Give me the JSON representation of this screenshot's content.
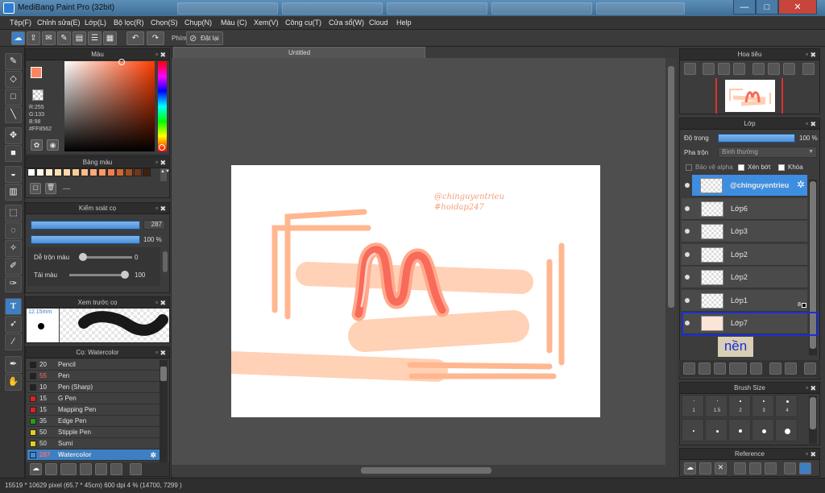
{
  "window": {
    "title": "MediBang Paint Pro (32bit)",
    "minimize": "—",
    "maximize": "□",
    "close": "✕"
  },
  "menu": [
    "Tệp(F)",
    "Chỉnh sửa(E)",
    "Lớp(L)",
    "Bộ lọc(R)",
    "Chọn(S)",
    "Chụp(N)",
    "Màu (C)",
    "Xem(V)",
    "Công cụ(T)",
    "Cửa sổ(W)",
    "Cloud",
    "Help"
  ],
  "toolbar": {
    "snap_label": "Phím",
    "reset_label": "Đặt lại"
  },
  "color_panel": {
    "title": "Màu",
    "r": "R:255",
    "g": "G:133",
    "b": "B:98",
    "hex": "#FF8562",
    "main_color": "#ff8562"
  },
  "palette_panel": {
    "title": "Bảng màu",
    "dash": "---",
    "swatches": [
      "#ffffff",
      "#fff6e8",
      "#ffeccc",
      "#ffe0b2",
      "#ffd9a8",
      "#ffcc99",
      "#ffbb88",
      "#ffaa77",
      "#ff9966",
      "#f08050",
      "#d06a35",
      "#a05020",
      "#703818",
      "#402010"
    ]
  },
  "brush_control": {
    "title": "Kiểm soát cọ",
    "size_value": "287",
    "opacity_value": "100 %",
    "blend_label": "Dễ trộn màu",
    "blend_value": "0",
    "amount_label": "Tải màu",
    "amount_value": "100"
  },
  "brush_preview": {
    "title": "Xem trước cọ",
    "size_label": "12.15mm"
  },
  "brush_list": {
    "title": "Cọ: Watercolor",
    "items": [
      {
        "size": "20",
        "name": "Pencil",
        "color": "#222222"
      },
      {
        "size": "55",
        "name": "Pen",
        "color": "#222222"
      },
      {
        "size": "10",
        "name": "Pen (Sharp)",
        "color": "#222222"
      },
      {
        "size": "15",
        "name": "G Pen",
        "color": "#e02020"
      },
      {
        "size": "15",
        "name": "Mapping Pen",
        "color": "#e02020"
      },
      {
        "size": "35",
        "name": "Edge Pen",
        "color": "#20a020"
      },
      {
        "size": "50",
        "name": "Stipple Pen",
        "color": "#e0d020"
      },
      {
        "size": "50",
        "name": "Sumi",
        "color": "#e0d020"
      },
      {
        "size": "287",
        "name": "Watercolor",
        "color": "#3a8ee6"
      }
    ]
  },
  "canvas": {
    "tab_title": "Untitled",
    "watermark_line1": "@chinguyentrieu",
    "watermark_line2": "#hoidap247"
  },
  "navigator": {
    "title": "Hoa tiêu"
  },
  "layer_panel": {
    "title": "Lớp",
    "opacity_label": "Độ trong",
    "opacity_value": "100 %",
    "blend_label": "Pha trộn",
    "blend_value": "Bình thường",
    "protect_alpha": "Bảo vệ alpha",
    "clipping": "Xén bớt",
    "lock": "Khóa",
    "layers": [
      {
        "name": "@chinguyentrieu",
        "selected": true
      },
      {
        "name": "Lớp6",
        "selected": false
      },
      {
        "name": "Lớp3",
        "selected": false
      },
      {
        "name": "Lớp2",
        "selected": false
      },
      {
        "name": "Lớp2",
        "selected": false
      },
      {
        "name": "Lớp1",
        "selected": false
      },
      {
        "name": "Lớp7",
        "selected": false
      }
    ],
    "annotation": "nền",
    "layer1_badge": "8"
  },
  "brush_size_panel": {
    "title": "Brush Size",
    "sizes": [
      "1",
      "1.5",
      "2",
      "3",
      "4"
    ]
  },
  "reference_panel": {
    "title": "Reference"
  },
  "status": {
    "text": "15519 * 10629 pixel  (65.7 * 45cm)  600 dpi  4 %  (14700, 7299 )"
  }
}
